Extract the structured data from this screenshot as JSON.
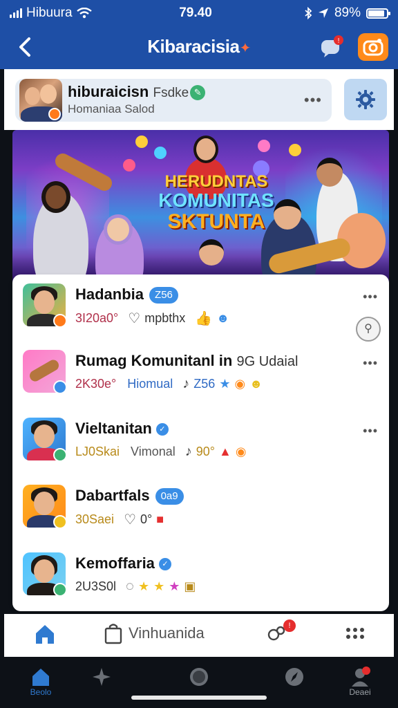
{
  "status_bar": {
    "carrier": "Hibuura",
    "time": "79.40",
    "battery": "89%",
    "battery_level": 0.89
  },
  "nav": {
    "title": "Kibaracisia",
    "icons": [
      "back-chevron-icon",
      "chat-bubble-icon",
      "camera-icon"
    ]
  },
  "group": {
    "name": "hiburaicisn",
    "tag": "Fsdke",
    "subtitle": "Homaniaa Salod",
    "more": "•••"
  },
  "banner": {
    "line1": "HERUDNTAS",
    "line2": "KOMUNITAS",
    "line3": "SKTUNTA"
  },
  "communities": [
    {
      "name": "Hadanbia",
      "pill": "Z56",
      "count": "3I20a0°",
      "label": "mpbthx",
      "more": "•••"
    },
    {
      "name": "Rumag Komunitanl in",
      "extra": "9G Udaial",
      "count": "2K30e°",
      "label": "Hiomual",
      "value": "Z56",
      "more": "•••"
    },
    {
      "name": "Vieltanitan",
      "count": "LJ0Skai",
      "label": "Vimonal",
      "value": "90°",
      "more": "•••"
    },
    {
      "name": "Dabartfals",
      "pill": "0a9",
      "count": "30Saei",
      "value": "0°",
      "more": ""
    },
    {
      "name": "Kemoffaria",
      "count": "2U3S0l",
      "more": ""
    }
  ],
  "action_bar": {
    "bag_label": "Vinhuanida"
  },
  "bottom_tabs": [
    {
      "label": "Beolo"
    },
    {
      "label": ""
    },
    {
      "label": ""
    },
    {
      "label": ""
    },
    {
      "label": "Deaei"
    }
  ],
  "colors": {
    "header_blue": "#1e4fa6",
    "accent_orange": "#ff8a1a",
    "pill_blue": "#3a8ee6",
    "badge_red": "#e52d2d"
  }
}
